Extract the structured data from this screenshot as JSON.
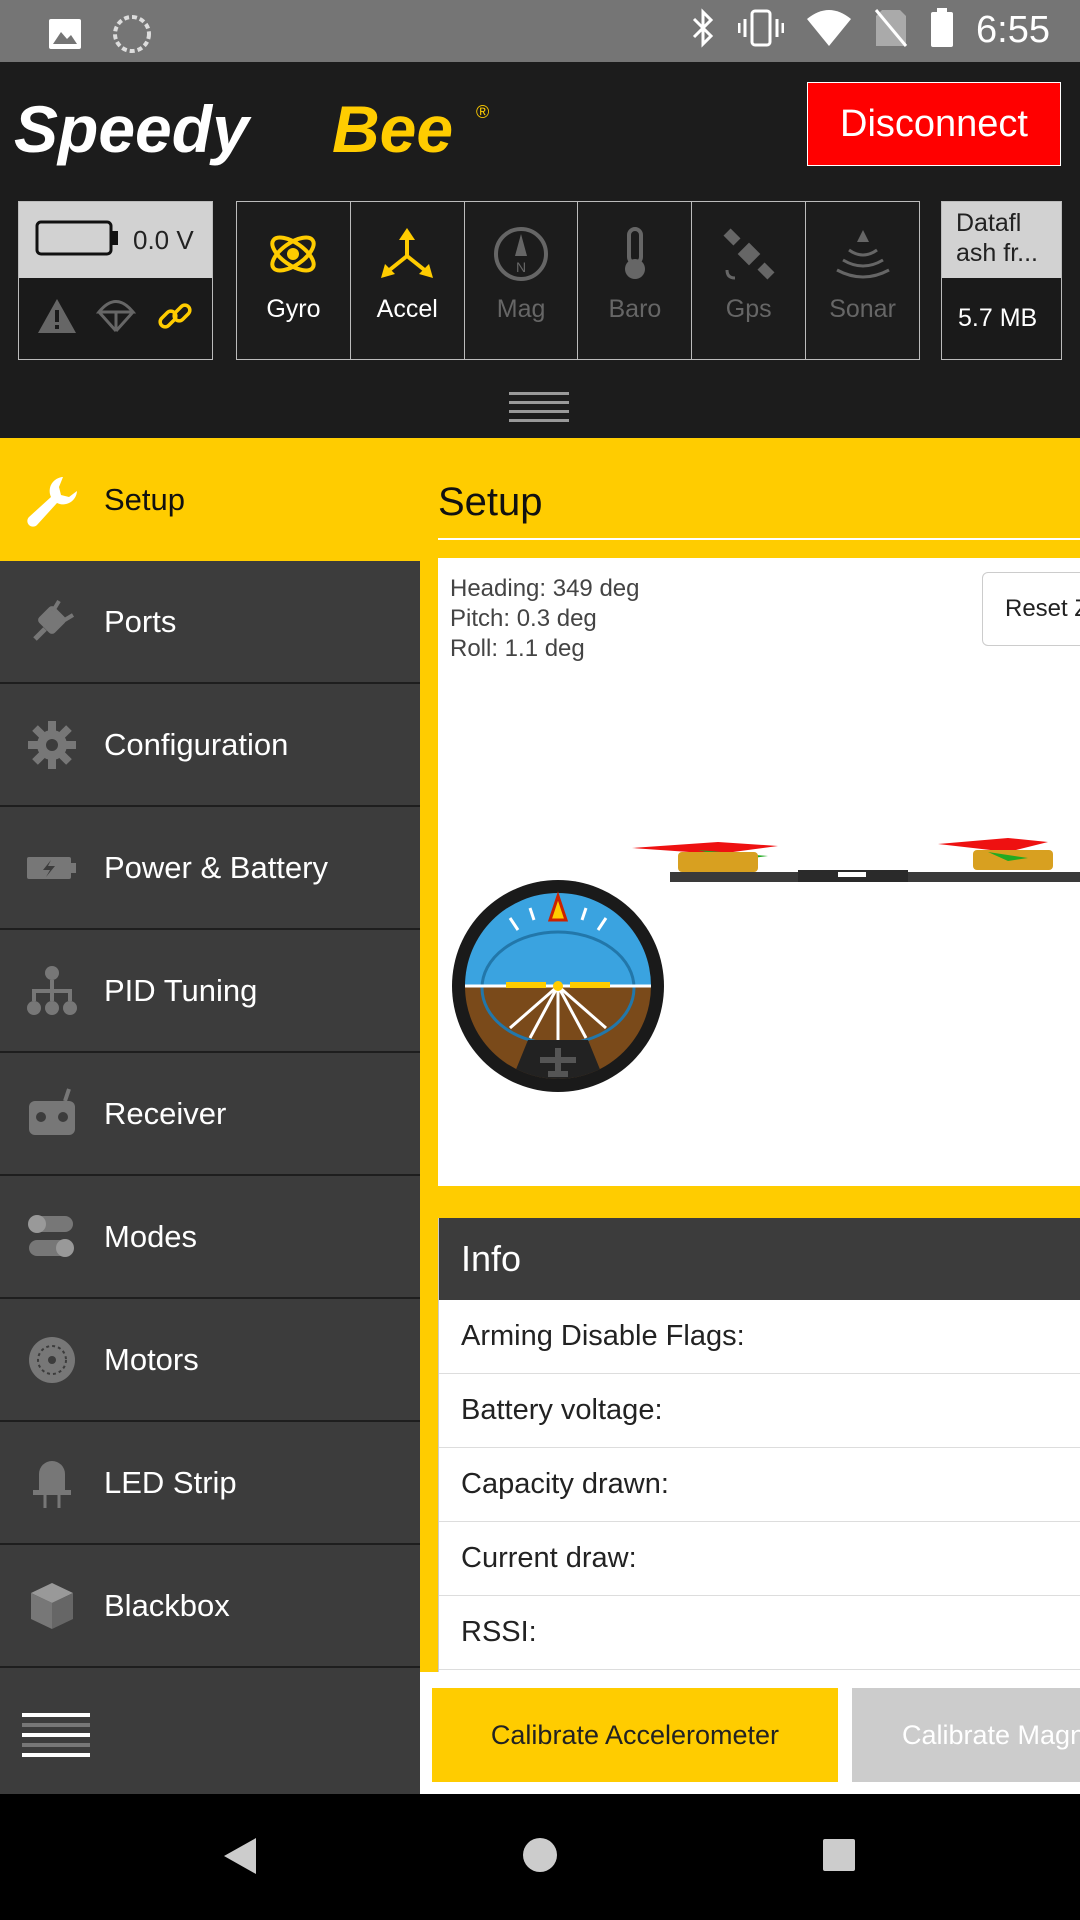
{
  "status_bar": {
    "time": "6:55",
    "icons": [
      "image-icon",
      "sync-icon",
      "bluetooth-icon",
      "vibrate-icon",
      "wifi-icon",
      "no-sim-icon",
      "battery-icon"
    ]
  },
  "header": {
    "logo_text": "SpeedyBee",
    "disconnect_label": "Disconnect",
    "battery": {
      "voltage": "0.0 V",
      "icons": [
        "warning-icon",
        "parachute-icon",
        "link-icon"
      ]
    },
    "sensors": [
      {
        "label": "Gyro",
        "active": true,
        "icon": "gyro-icon"
      },
      {
        "label": "Accel",
        "active": true,
        "icon": "accel-icon"
      },
      {
        "label": "Mag",
        "active": false,
        "icon": "compass-icon"
      },
      {
        "label": "Baro",
        "active": false,
        "icon": "thermometer-icon"
      },
      {
        "label": "Gps",
        "active": false,
        "icon": "satellite-icon"
      },
      {
        "label": "Sonar",
        "active": false,
        "icon": "sonar-icon"
      }
    ],
    "dataflash": {
      "title": "Dataflash fr...",
      "title_line1": "Datafl",
      "title_line2": "ash fr...",
      "size": "5.7 MB"
    }
  },
  "sidebar": {
    "items": [
      {
        "label": "Setup",
        "icon": "wrench-icon",
        "active": true
      },
      {
        "label": "Ports",
        "icon": "plug-icon"
      },
      {
        "label": "Configuration",
        "icon": "gear-icon"
      },
      {
        "label": "Power & Battery",
        "icon": "battery-charge-icon"
      },
      {
        "label": "PID Tuning",
        "icon": "hierarchy-icon"
      },
      {
        "label": "Receiver",
        "icon": "remote-control-icon"
      },
      {
        "label": "Modes",
        "icon": "toggles-icon"
      },
      {
        "label": "Motors",
        "icon": "motor-icon"
      },
      {
        "label": "LED Strip",
        "icon": "led-icon"
      },
      {
        "label": "Blackbox",
        "icon": "cube-icon"
      }
    ]
  },
  "main": {
    "title": "Setup",
    "attitude": {
      "heading": "Heading: 349 deg",
      "pitch": "Pitch: 0.3 deg",
      "roll": "Roll: 1.1 deg"
    },
    "reset_label": "Reset Z axis",
    "info": {
      "title": "Info",
      "rows": [
        "Arming Disable Flags:",
        "Battery voltage:",
        "Capacity drawn:",
        "Current draw:",
        "RSSI:"
      ]
    },
    "calibrate_accel_label": "Calibrate Accelerometer",
    "calibrate_mag_label": "Calibrate Magnetometer"
  },
  "colors": {
    "accent": "#ffcc00",
    "disconnect": "#ff0000",
    "sidebar": "#3c3c3c",
    "header": "#1c1c1c"
  }
}
